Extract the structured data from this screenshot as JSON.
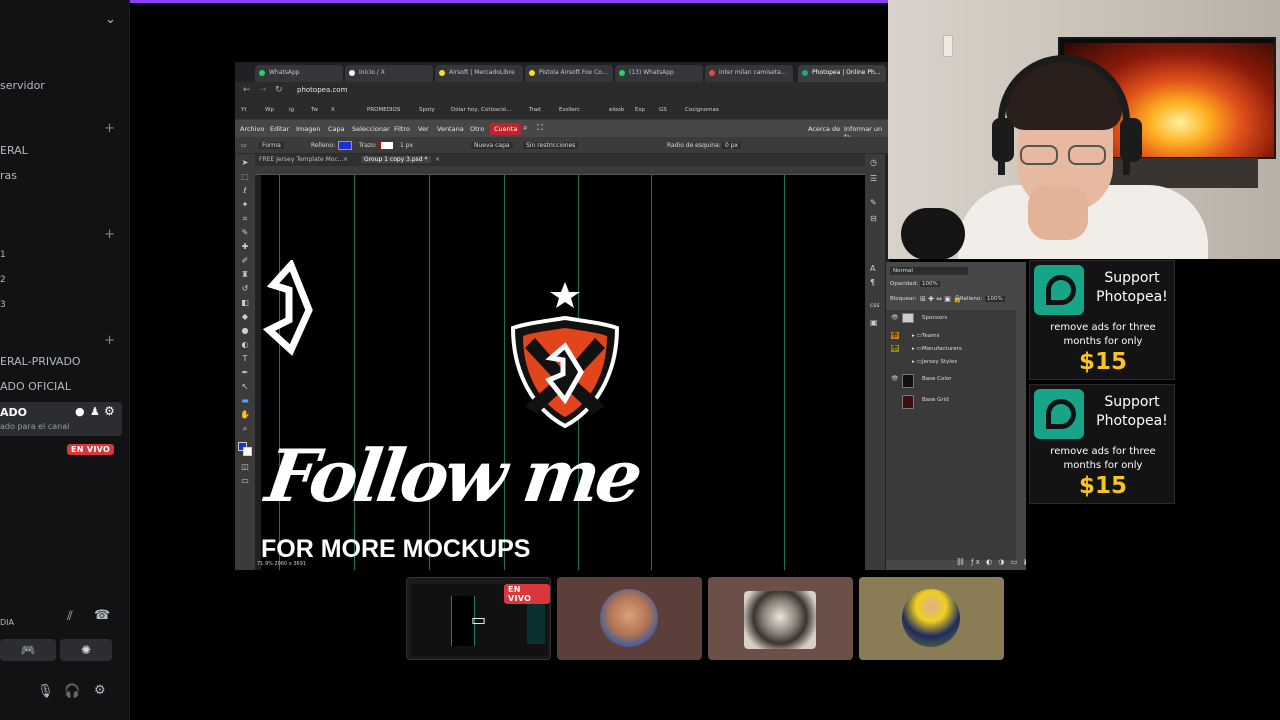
{
  "sidebar": {
    "items": [
      {
        "label": "servidor"
      },
      {
        "label": "ERAL"
      },
      {
        "label": "ras"
      },
      {
        "label": "ERAL-PRIVADO"
      },
      {
        "label": "ADO OFICIAL"
      },
      {
        "label": "ADO"
      },
      {
        "label": "ado para el canal"
      }
    ],
    "small_numbers": [
      "1",
      "2",
      "3"
    ],
    "live_badge": "EN VIVO",
    "voice_label": "DIA"
  },
  "browser": {
    "tabs": [
      {
        "label": "WhatsApp",
        "color": "#25d366"
      },
      {
        "label": "Inicio / X",
        "color": "#ffffff"
      },
      {
        "label": "Airsoft | MercadoLibre",
        "color": "#f7e11b"
      },
      {
        "label": "Pistola Airsoft Fox Co...",
        "color": "#f7e11b"
      },
      {
        "label": "(13) WhatsApp",
        "color": "#25d366"
      },
      {
        "label": "inter milan camiseta...",
        "color": "#e04a3f"
      },
      {
        "label": "Photopea | Online Ph...",
        "color": "#18a497"
      }
    ],
    "url": "photopea.com",
    "bookmarks": [
      "Yt",
      "Wp",
      "ig",
      "Tw",
      "X",
      "PROMEDIOS",
      "Spoty",
      "Dólar hoy, Cotizació...",
      "Trad",
      "Essllerc",
      "eloob",
      "Esp",
      "GS",
      "Cocignomas"
    ]
  },
  "photopea": {
    "menu": [
      "Archivo",
      "Editar",
      "Imagen",
      "Capa",
      "Seleccionar",
      "Filtro",
      "Ver",
      "Ventana",
      "Otro"
    ],
    "cuenta": "Cuenta",
    "menu_right": [
      "Acerca de",
      "Informar un fa"
    ],
    "options": [
      "Forma",
      "Relleno:",
      "Trazo:",
      "1 px",
      "Nueva capa",
      "Sin restricciones",
      "Radio de esquina:",
      "0 px"
    ],
    "doc_tabs": [
      "FREE Jersey Template Moc...",
      "Group 1 copy 3.psd *"
    ],
    "canvas_text": {
      "line1": "Follow me",
      "line2": "FOR MORE MOCKUPS"
    },
    "status": "71.9% 2060 x 3691",
    "layers": {
      "blend_mode": "Normal",
      "opacity_label": "Opacidad:",
      "opacity": "100%",
      "lock_label": "Bloquear:",
      "fill_label": "Relleno:",
      "fill": "100%",
      "rows": [
        {
          "name": "Sponsors"
        },
        {
          "name": "Teams"
        },
        {
          "name": "Manufacturers"
        },
        {
          "name": "Jersey Styles"
        },
        {
          "name": "Base Color"
        },
        {
          "name": "Base Grid"
        }
      ]
    }
  },
  "ads": [
    {
      "title": "Support Photopea!",
      "subtitle": "remove ads for three months for only",
      "price": "$15"
    },
    {
      "title": "Support Photopea!",
      "subtitle": "remove ads for three months for only",
      "price": "$15"
    }
  ],
  "streams": {
    "live_badge": "EN VIVO"
  }
}
